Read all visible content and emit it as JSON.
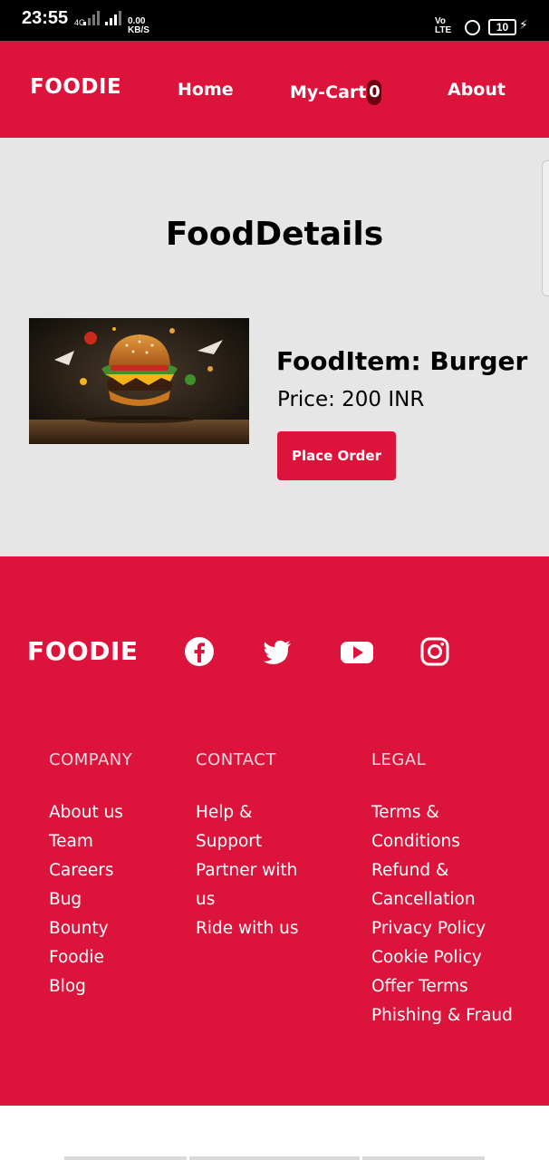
{
  "status_bar": {
    "time": "23:55",
    "net_type": "4G",
    "speed_value": "0.00",
    "speed_unit": "KB/S",
    "volte_top": "Vo",
    "volte_bottom": "LTE",
    "battery": "10",
    "icons": [
      "signal-icon",
      "wifi-icon",
      "lock-icon",
      "battery-icon",
      "charging-icon"
    ]
  },
  "header": {
    "brand": "FOODIE",
    "nav": {
      "home": "Home",
      "cart": "My-Cart",
      "cart_count": "0",
      "about": "About"
    }
  },
  "main": {
    "title": "FoodDetails",
    "item": {
      "image_alt": "burger-image",
      "name_label": "FoodItem: Burger",
      "price_label": "Price: 200 INR",
      "order_button": "Place Order"
    }
  },
  "footer": {
    "brand": "FOODIE",
    "social_icons": [
      "facebook-icon",
      "twitter-icon",
      "youtube-icon",
      "instagram-icon"
    ],
    "columns": [
      {
        "heading": "COMPANY",
        "links": [
          "About us",
          "Team",
          "Careers",
          "Bug",
          "Bounty",
          "Foodie",
          "Blog"
        ]
      },
      {
        "heading": "CONTACT",
        "links": [
          "Help &",
          "Support",
          "Partner with",
          "us",
          "Ride with us"
        ]
      },
      {
        "heading": "LEGAL",
        "links": [
          "Terms &",
          "Conditions",
          "Refund &",
          "Cancellation",
          "Privacy Policy",
          "Cookie Policy",
          "Offer Terms",
          "Phishing & Fraud"
        ]
      }
    ]
  },
  "colors": {
    "brand": "#dc143c",
    "background": "#e6e6e6",
    "badge": "#6e0010"
  }
}
